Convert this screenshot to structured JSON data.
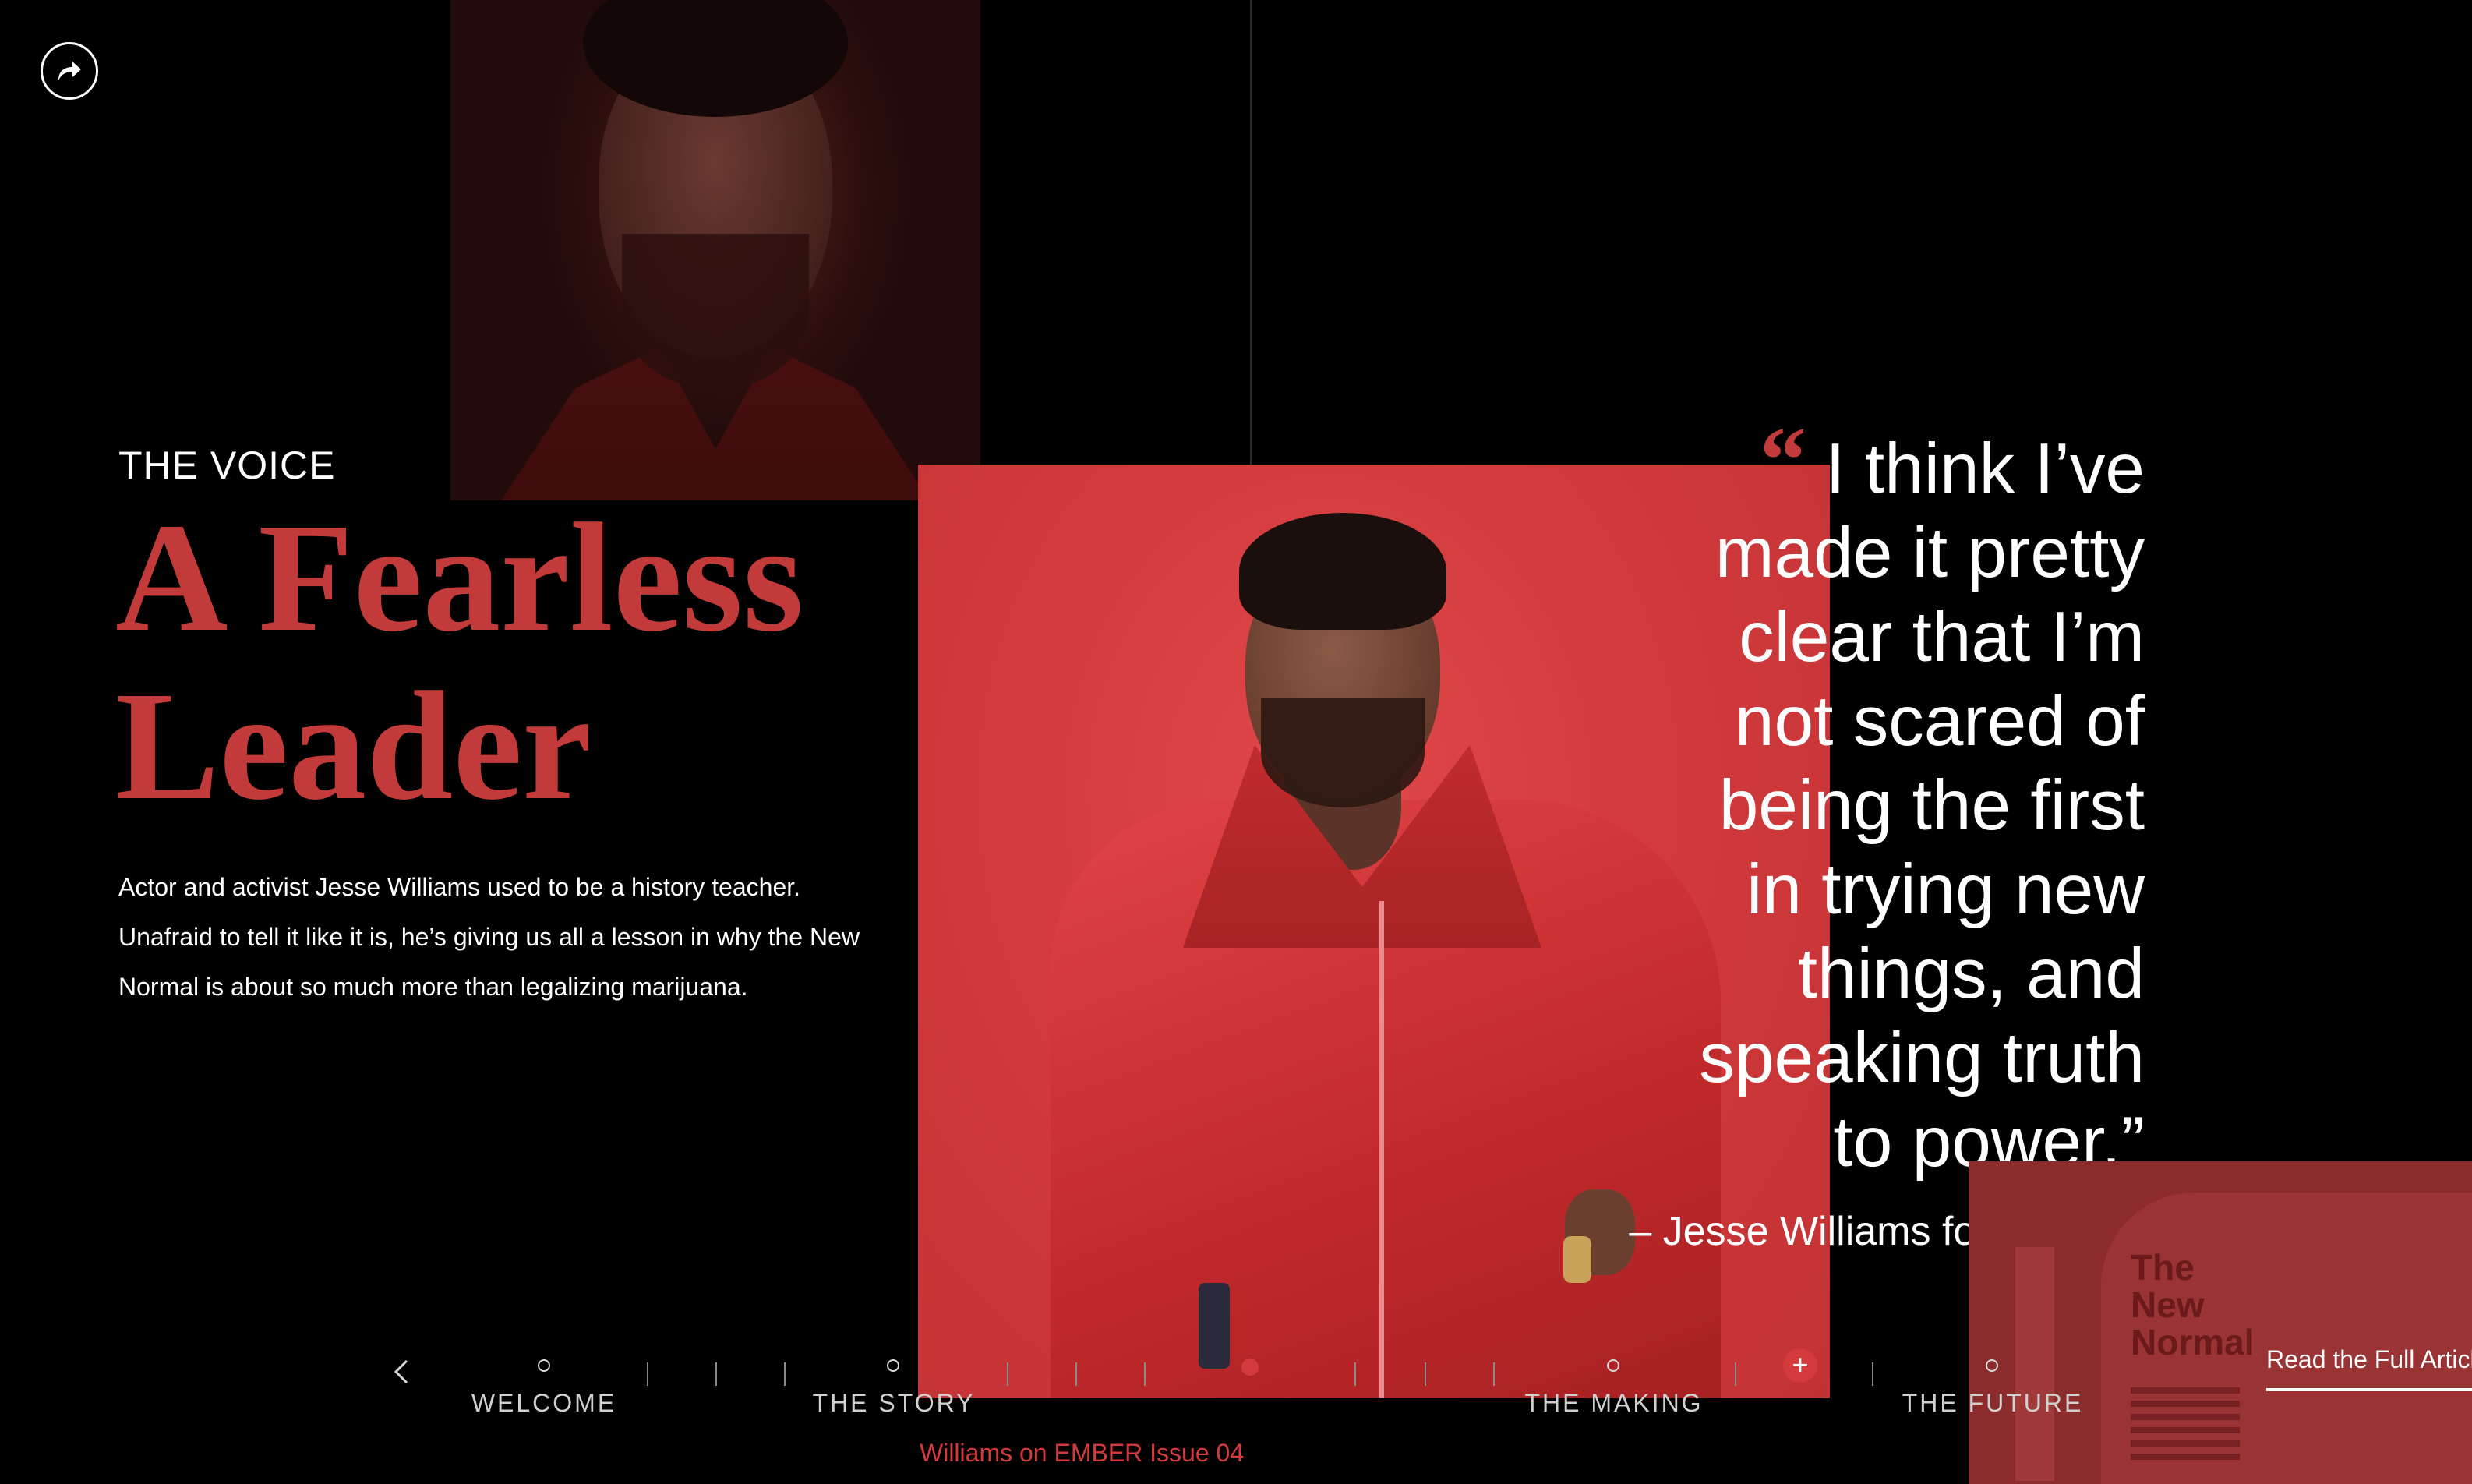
{
  "section": {
    "kicker": "THE VOICE",
    "headline_line1": "A Fearless",
    "headline_line2": "Leader",
    "intro_line1": "Actor and activist Jesse Williams used to be a history teacher.",
    "intro_line2": "Unafraid to tell it like it is, he’s giving us all a lesson in why the New",
    "intro_line3": "Normal is about so much more than legalizing marijuana."
  },
  "quote": {
    "mark": "“",
    "lines": [
      "I think I’ve",
      "made it pretty",
      "clear that I’m",
      "not scared of",
      "being the first",
      "in trying new",
      "things, and",
      "speaking truth",
      "to power.”"
    ],
    "attribution": "– Jesse Williams for EMBER"
  },
  "magazine": {
    "title_line1": "The",
    "title_line2": "New",
    "title_line3": "Normal",
    "read_full": "Read the Full Article"
  },
  "nav": {
    "items": [
      {
        "label": "WELCOME"
      },
      {
        "label": "THE STORY"
      },
      {
        "label": "THE MAKING"
      },
      {
        "label": "THE FUTURE"
      }
    ],
    "issue_label": "Williams on EMBER Issue 04"
  },
  "icons": {
    "share": "share-arrow-icon",
    "prev": "chevron-left-icon",
    "plus": "plus-icon"
  },
  "colors": {
    "accent_red": "#c33a3b",
    "background": "#000000"
  }
}
